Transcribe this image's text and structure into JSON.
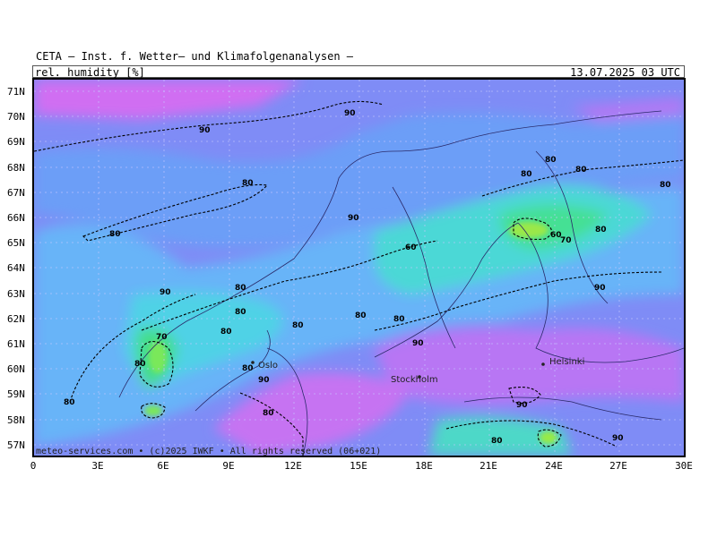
{
  "header": {
    "provider": "CETA — Inst. f. Wetter— und Klimafolgenanalysen —",
    "parameter": "rel. humidity [%]",
    "valid_time": "13.07.2025 03 UTC"
  },
  "map": {
    "lat_labels": [
      "71N",
      "70N",
      "69N",
      "68N",
      "67N",
      "66N",
      "65N",
      "64N",
      "63N",
      "62N",
      "61N",
      "60N",
      "59N",
      "58N",
      "57N"
    ],
    "lon_labels": [
      "0",
      "3E",
      "6E",
      "9E",
      "12E",
      "15E",
      "18E",
      "21E",
      "24E",
      "27E",
      "30E"
    ],
    "cities": {
      "oslo": "Oslo",
      "stockholm": "Stockholm",
      "helsinki": "Helsinki"
    },
    "contour_labels": [
      "90",
      "90",
      "80",
      "80",
      "90",
      "80",
      "60",
      "80",
      "80",
      "60",
      "70",
      "80",
      "90",
      "80",
      "80",
      "80",
      "80",
      "70",
      "80",
      "80",
      "80",
      "90",
      "90",
      "80",
      "80",
      "90",
      "80",
      "90",
      "90",
      "80",
      "80"
    ],
    "credit": "meteo-services.com • (c)2025 IWKF • All rights reserved (06+021)"
  },
  "colors": {
    "rh_100": "#e06cf0",
    "rh_90": "#8a80f4",
    "rh_85": "#6aa6f6",
    "rh_75": "#4ad7e0",
    "rh_65": "#40e08a",
    "rh_55": "#a6f040",
    "coast": "#2a2a6a"
  }
}
